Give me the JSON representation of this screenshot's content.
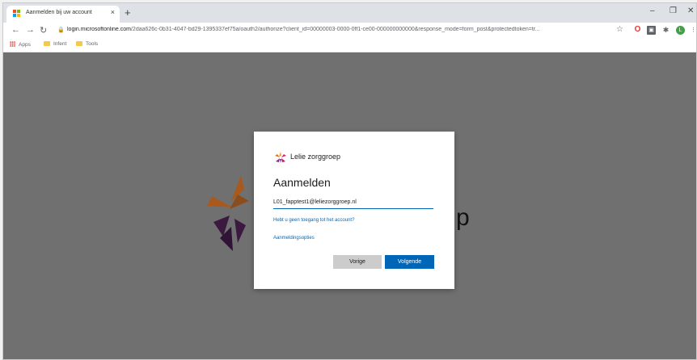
{
  "browser": {
    "tab_title": "Aanmelden bij uw account",
    "url": {
      "host": "login.microsoftonline.com",
      "path": "/2daa626c-0b31-4047-bd29-1395337ef75a/oauth2/authorize?client_id=00000003-0000-0ff1-ce00-000000000000&response_mode=form_post&protectedtoken=tr..."
    },
    "bookmarks": [
      "Apps",
      "Infent",
      "Tools"
    ],
    "profile_initial": "L"
  },
  "login": {
    "brand": "Lelie zorggroep",
    "heading": "Aanmelden",
    "email_value": "L01_fapptest1@leliezorggroep.nl",
    "no_access_link": "Hebt u geen toegang tot het account?",
    "options_link": "Aanmeldingsopties",
    "back_button": "Vorige",
    "next_button": "Volgende"
  },
  "background_fragment": "p",
  "colors": {
    "accent": "#0067b8",
    "page_bg": "#707070"
  }
}
